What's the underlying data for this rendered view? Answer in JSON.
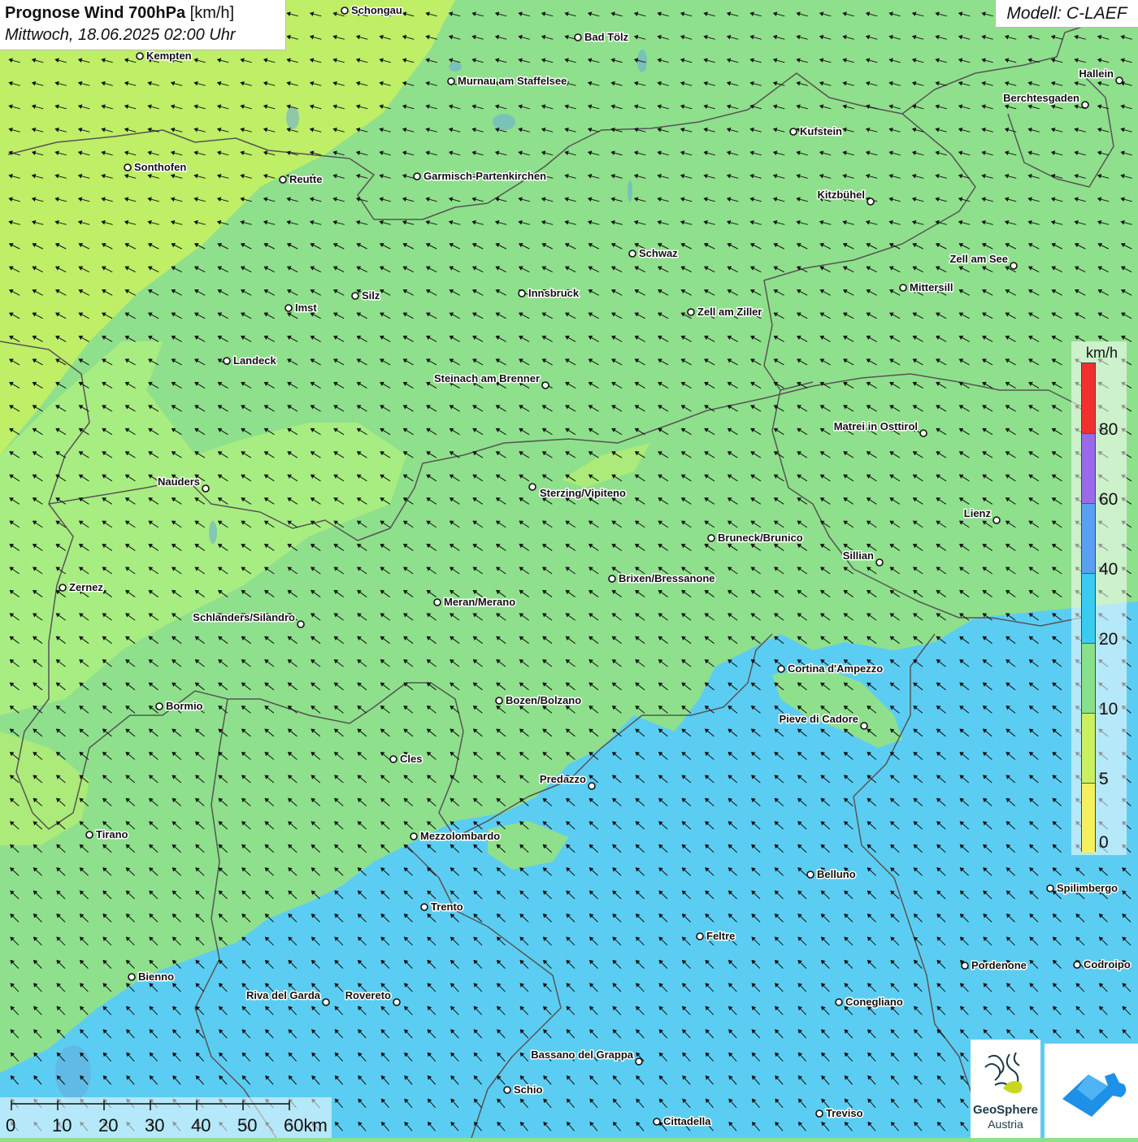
{
  "header": {
    "title_main": "Prognose Wind 700hPa",
    "title_unit": "[km/h]",
    "datetime": "Mittwoch, 18.06.2025 02:00 Uhr",
    "model": "Modell: C-LAEF"
  },
  "legend": {
    "unit": "km/h",
    "ticks": [
      "80",
      "60",
      "40",
      "20",
      "10",
      "5",
      "0"
    ],
    "bands": [
      {
        "from": 80,
        "color": "#f03030"
      },
      {
        "from": 60,
        "color": "#9a6ae8"
      },
      {
        "from": 40,
        "color": "#5aa0f0"
      },
      {
        "from": 20,
        "color": "#3ccaf2"
      },
      {
        "from": 10,
        "color": "#88e088"
      },
      {
        "from": 5,
        "color": "#c8f060"
      },
      {
        "from": 0,
        "color": "#f4f060"
      }
    ]
  },
  "scale_bar": {
    "labels": [
      "0",
      "10",
      "20",
      "30",
      "40",
      "50",
      "60km"
    ]
  },
  "logos": {
    "geosphere_name": "GeoSphere",
    "geosphere_sub": "Austria"
  },
  "cities": [
    {
      "name": "Schongau"
    },
    {
      "name": "Bad Tölz"
    },
    {
      "name": "Kempten"
    },
    {
      "name": "Murnau am Staffelsee"
    },
    {
      "name": "Hallein"
    },
    {
      "name": "Berchtesgaden"
    },
    {
      "name": "Kufstein"
    },
    {
      "name": "Sonthofen"
    },
    {
      "name": "Reutte"
    },
    {
      "name": "Garmisch-Partenkirchen"
    },
    {
      "name": "Kitzbühel"
    },
    {
      "name": "Schwaz"
    },
    {
      "name": "Zell am See"
    },
    {
      "name": "Mittersill"
    },
    {
      "name": "Imst"
    },
    {
      "name": "Silz"
    },
    {
      "name": "Innsbruck"
    },
    {
      "name": "Zell am Ziller"
    },
    {
      "name": "Landeck"
    },
    {
      "name": "Steinach am Brenner"
    },
    {
      "name": "Matrei in Osttirol"
    },
    {
      "name": "Nauders"
    },
    {
      "name": "Sterzing/Vipiteno"
    },
    {
      "name": "Lienz"
    },
    {
      "name": "Bruneck/Brunico"
    },
    {
      "name": "Sillian"
    },
    {
      "name": "Zernez"
    },
    {
      "name": "Brixen/Bressanone"
    },
    {
      "name": "Meran/Merano"
    },
    {
      "name": "Schlanders/Silandro"
    },
    {
      "name": "Cortina d'Ampezzo"
    },
    {
      "name": "Bormio"
    },
    {
      "name": "Bozen/Bolzano"
    },
    {
      "name": "Pieve di Cadore"
    },
    {
      "name": "Cles"
    },
    {
      "name": "Predazzo"
    },
    {
      "name": "Tirano"
    },
    {
      "name": "Mezzolombardo"
    },
    {
      "name": "Belluno"
    },
    {
      "name": "Spilimbergo"
    },
    {
      "name": "Trento"
    },
    {
      "name": "Feltre"
    },
    {
      "name": "Pordenone"
    },
    {
      "name": "Codroipo"
    },
    {
      "name": "Bienno"
    },
    {
      "name": "Riva del Garda"
    },
    {
      "name": "Rovereto"
    },
    {
      "name": "Conegliano"
    },
    {
      "name": "Bassano del Grappa"
    },
    {
      "name": "Schio"
    },
    {
      "name": "Treviso"
    },
    {
      "name": "Cittadella"
    }
  ],
  "colors": {
    "wind_below_5": "#c8f060",
    "wind_5_10": "#aef080",
    "wind_10_20": "#8fe08c",
    "wind_20_40": "#5ccdf2",
    "border": "#555555",
    "arrow": "#111111"
  }
}
